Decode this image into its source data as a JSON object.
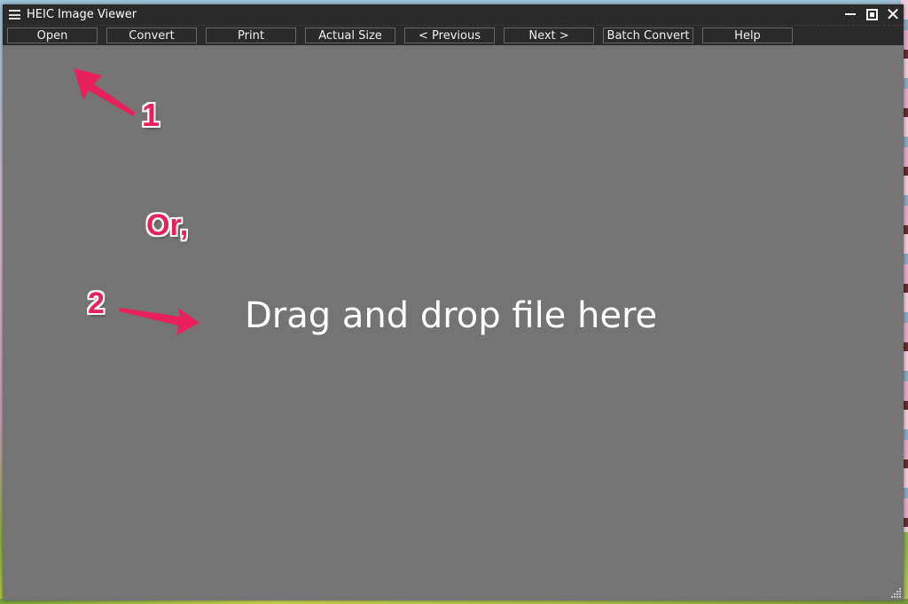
{
  "window": {
    "title": "HEIC Image Viewer",
    "controls": {
      "minimize": "minimize-icon",
      "maximize": "restore-icon",
      "close": "close-icon"
    }
  },
  "toolbar": {
    "buttons": [
      {
        "label": "Open"
      },
      {
        "label": "Convert"
      },
      {
        "label": "Print"
      },
      {
        "label": "Actual Size"
      },
      {
        "label": "< Previous"
      },
      {
        "label": "Next >"
      },
      {
        "label": "Batch Convert"
      },
      {
        "label": "Help"
      }
    ]
  },
  "content": {
    "drop_hint": "Drag and drop file here"
  },
  "annotations": {
    "step1": "1",
    "or": "Or,",
    "step2": "2",
    "color": "#e8205c"
  }
}
